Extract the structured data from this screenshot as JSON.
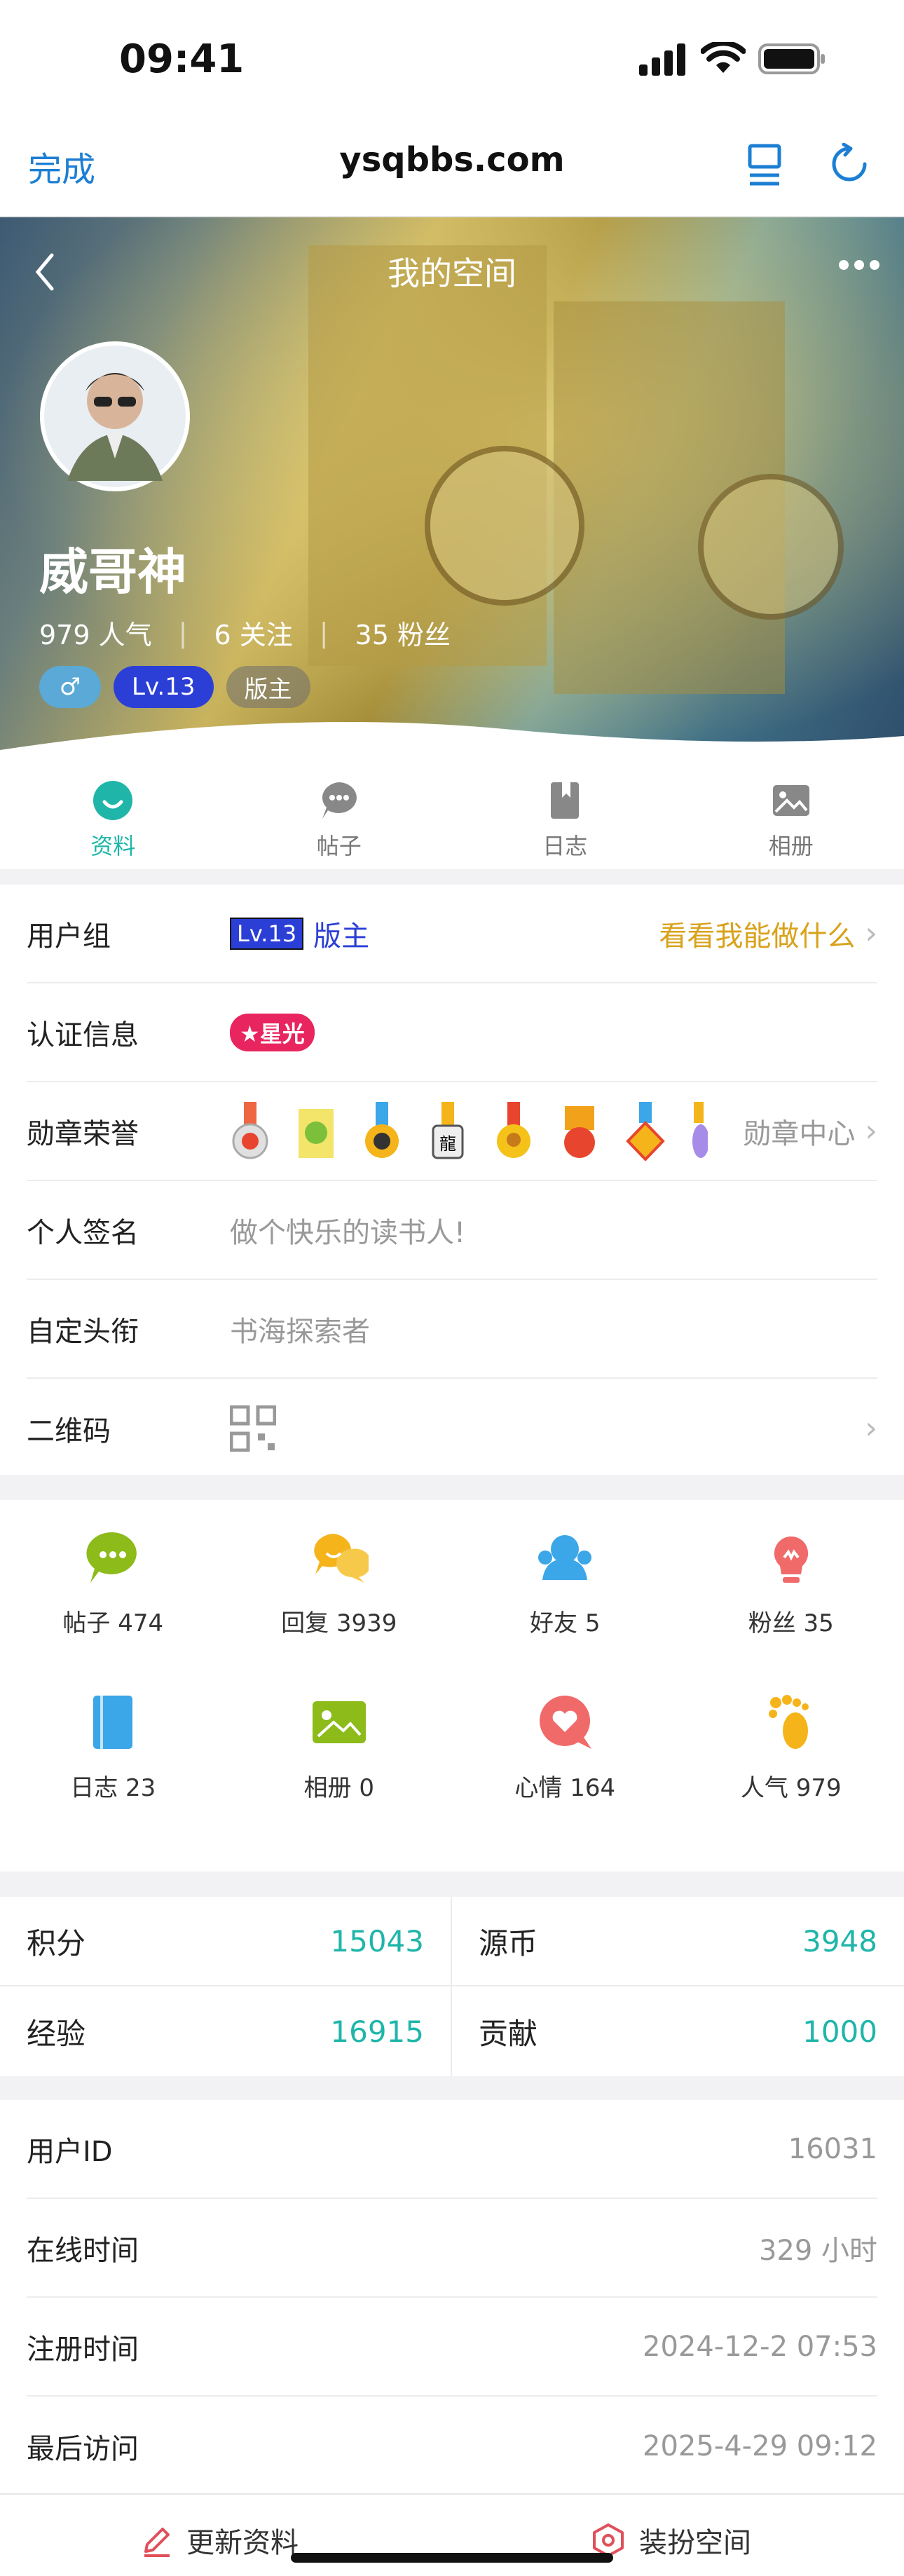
{
  "status_bar": {
    "time": "09:41"
  },
  "browser": {
    "done": "完成",
    "host": "ysqbbs.com"
  },
  "hero": {
    "title": "我的空间",
    "name": "威哥神",
    "popularity": "979 人气",
    "following": "6 关注",
    "fans": "35 粉丝",
    "level": "Lv.13",
    "role": "版主"
  },
  "tabs": [
    {
      "label": "资料"
    },
    {
      "label": "帖子"
    },
    {
      "label": "日志"
    },
    {
      "label": "相册"
    }
  ],
  "profile": {
    "group_label": "用户组",
    "group_level": "Lv.13",
    "group_role": "版主",
    "group_link": "看看我能做什么",
    "cert_label": "认证信息",
    "cert_badge": "★星光",
    "medal_label": "勋章荣誉",
    "medal_link": "勋章中心",
    "sign_label": "个人签名",
    "sign_value": "做个快乐的读书人!",
    "title_label": "自定头衔",
    "title_value": "书海探索者",
    "qr_label": "二维码"
  },
  "counts": [
    {
      "label": "帖子 474",
      "icon": "chat-bubble-icon",
      "color": "#8cbb1a"
    },
    {
      "label": "回复 3939",
      "icon": "reply-bubbles-icon",
      "color": "#f5b41a"
    },
    {
      "label": "好友 5",
      "icon": "friends-icon",
      "color": "#3ba6e8"
    },
    {
      "label": "粉丝 35",
      "icon": "fans-bulb-icon",
      "color": "#f06a6a"
    },
    {
      "label": "日志 23",
      "icon": "notebook-icon",
      "color": "#3ba6e8"
    },
    {
      "label": "相册 0",
      "icon": "photo-icon",
      "color": "#8cbb1a"
    },
    {
      "label": "心情 164",
      "icon": "heart-bubble-icon",
      "color": "#f06a6a"
    },
    {
      "label": "人气 979",
      "icon": "footprint-icon",
      "color": "#f5b41a"
    }
  ],
  "scores": {
    "points_label": "积分",
    "points": "15043",
    "coins_label": "源币",
    "coins": "3948",
    "exp_label": "经验",
    "exp": "16915",
    "contrib_label": "贡献",
    "contrib": "1000"
  },
  "info": {
    "uid_label": "用户ID",
    "uid": "16031",
    "online_label": "在线时间",
    "online": "329 小时",
    "reg_label": "注册时间",
    "reg": "2024-12-2 07:53",
    "last_label": "最后访问",
    "last": "2025-4-29 09:12"
  },
  "bottom": {
    "edit": "更新资料",
    "dress": "装扮空间"
  },
  "colors": {
    "accent": "#1fb6a9",
    "link": "#1c7fd4",
    "gold": "#d9a21b",
    "level_blue": "#2b3fd6"
  }
}
